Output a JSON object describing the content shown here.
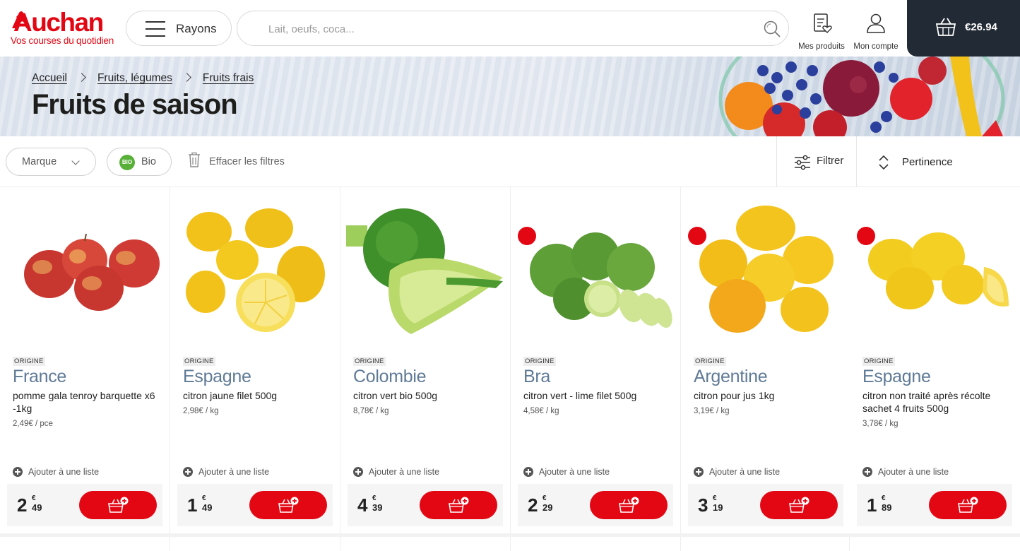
{
  "header": {
    "logo_word": "Auchan",
    "logo_tagline": "Vos courses du quotidien",
    "rayons_label": "Rayons",
    "search_placeholder": "Lait, oeufs, coca...",
    "mes_produits_label": "Mes produits",
    "mon_compte_label": "Mon compte",
    "cart_total": "€26.94"
  },
  "breadcrumb": [
    "Accueil",
    "Fruits, légumes",
    "Fruits frais"
  ],
  "page_title": "Fruits de saison",
  "filters": {
    "marque_label": "Marque",
    "bio_badge": "BIO",
    "bio_label": "Bio",
    "clear_label": "Effacer les filtres",
    "filtrer_label": "Filtrer",
    "sort_label": "Pertinence"
  },
  "colors": {
    "brand_red": "#e30613",
    "cart_bg": "#222a35",
    "country_text": "#5f7a96",
    "bio_green": "#58b039"
  },
  "products": [
    {
      "badge": "none",
      "origin_tag": "ORIGINE",
      "country": "France",
      "name": "pomme gala tenroy barquette x6 -1kg",
      "unit_price": "2,49€ / pce",
      "add_list": "Ajouter à une liste",
      "price_int": "2",
      "price_cur": "€",
      "price_dec": "49",
      "image": "red-apples"
    },
    {
      "badge": "none",
      "origin_tag": "ORIGINE",
      "country": "Espagne",
      "name": "citron jaune filet 500g",
      "unit_price": "2,98€ / kg",
      "add_list": "Ajouter à une liste",
      "price_int": "1",
      "price_cur": "€",
      "price_dec": "49",
      "image": "yellow-lemons"
    },
    {
      "badge": "bio",
      "origin_tag": "ORIGINE",
      "country": "Colombie",
      "name": "citron vert bio 500g",
      "unit_price": "8,78€ / kg",
      "add_list": "Ajouter à une liste",
      "price_int": "4",
      "price_cur": "€",
      "price_dec": "39",
      "image": "limes-cut"
    },
    {
      "badge": "rocket",
      "origin_tag": "ORIGINE",
      "country": "Bra",
      "name": "citron vert - lime filet 500g",
      "unit_price": "4,58€ / kg",
      "add_list": "Ajouter à une liste",
      "price_int": "2",
      "price_cur": "€",
      "price_dec": "29",
      "image": "limes-sliced"
    },
    {
      "badge": "rocket",
      "origin_tag": "ORIGINE",
      "country": "Argentine",
      "name": "citron pour jus 1kg",
      "unit_price": "3,19€ / kg",
      "add_list": "Ajouter à une liste",
      "price_int": "3",
      "price_cur": "€",
      "price_dec": "19",
      "image": "juice-lemons"
    },
    {
      "badge": "rocket",
      "origin_tag": "ORIGINE",
      "country": "Espagne",
      "name": "citron non traité après récolte sachet 4 fruits 500g",
      "unit_price": "3,78€ / kg",
      "add_list": "Ajouter à une liste",
      "price_int": "1",
      "price_cur": "€",
      "price_dec": "89",
      "image": "lemons-wedge"
    }
  ]
}
